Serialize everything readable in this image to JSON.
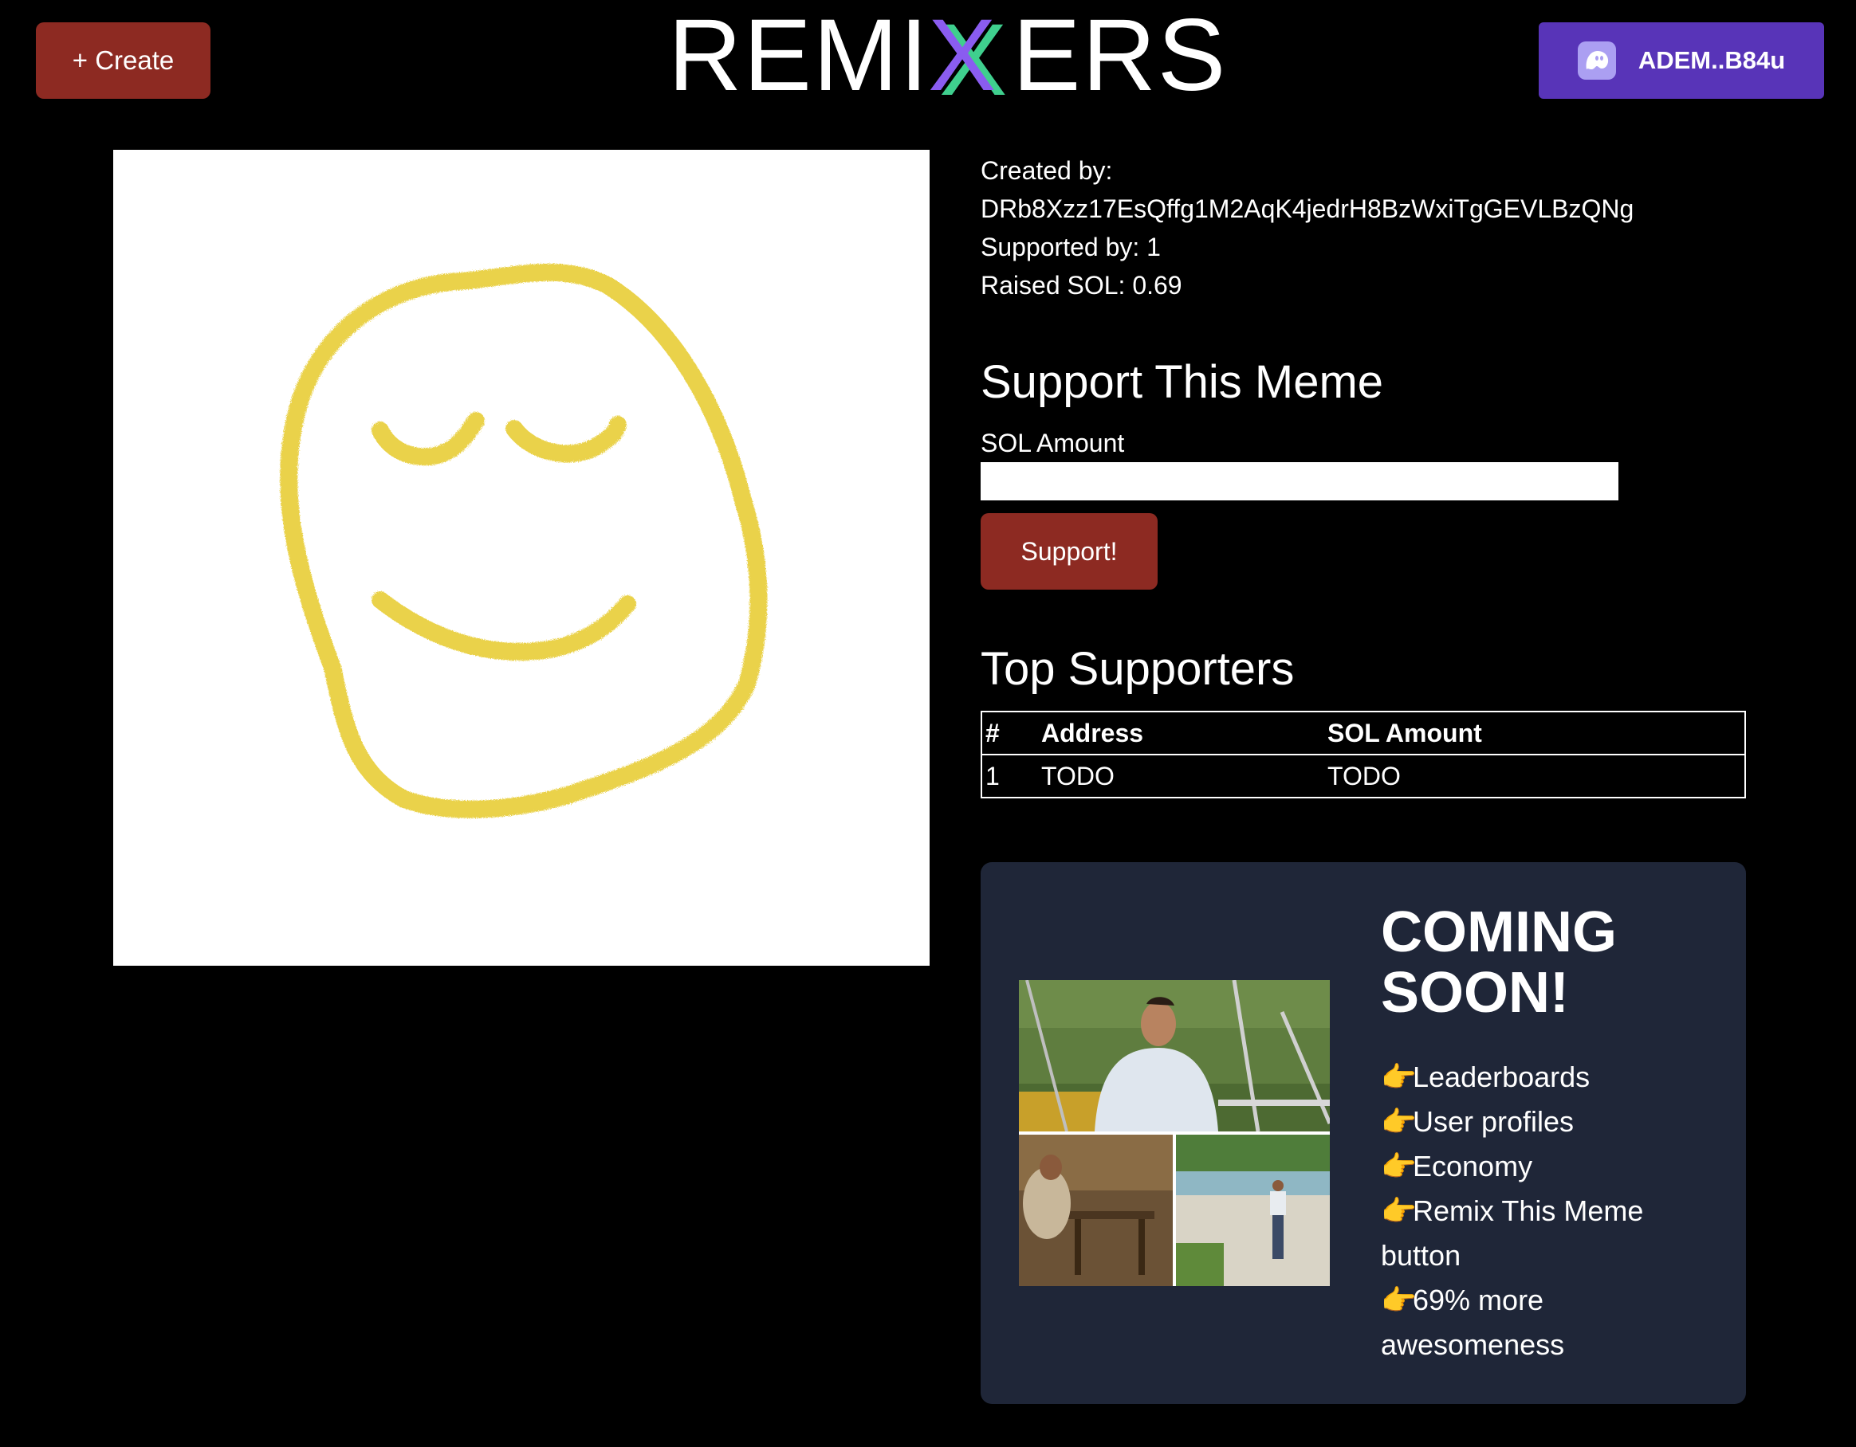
{
  "header": {
    "create_label": "+ Create",
    "logo_text_left": "REMI",
    "logo_text_x": "X",
    "logo_text_right": "ERS",
    "wallet_label": "ADEM..B84u",
    "wallet_icon": "phantom-ghost-icon"
  },
  "meme": {
    "image": "yellow-smiley-face-drawing"
  },
  "info": {
    "created_by_label": "Created by:",
    "creator_address": "DRb8Xzz17EsQffg1M2AqK4jedrH8BzWxiTgGEVLBzQNg",
    "supported_by": "Supported by: 1",
    "raised_sol": "Raised SOL: 0.69"
  },
  "support": {
    "title": "Support This Meme",
    "amount_label": "SOL Amount",
    "amount_value": "",
    "button_label": "Support!"
  },
  "top_supporters": {
    "title": "Top Supporters",
    "columns": [
      "#",
      "Address",
      "SOL Amount"
    ],
    "rows": [
      [
        "1",
        "TODO",
        "TODO"
      ]
    ]
  },
  "coming_soon": {
    "title_line1": "COMING",
    "title_line2": "SOON!",
    "image": "waiting-man-meme-collage",
    "bullet_icon": "pointing-hand-icon",
    "features": [
      "Leaderboards",
      "User profiles",
      "Economy",
      "Remix This Meme button",
      "69% more awesomeness"
    ]
  },
  "colors": {
    "background": "#000000",
    "button_red": "#8d2a22",
    "wallet_purple": "#5834b8",
    "card_bg": "#1f2638",
    "smiley_yellow": "#e9cf3a",
    "logo_green": "#3fcf8e",
    "logo_purple": "#8a5cf0"
  }
}
